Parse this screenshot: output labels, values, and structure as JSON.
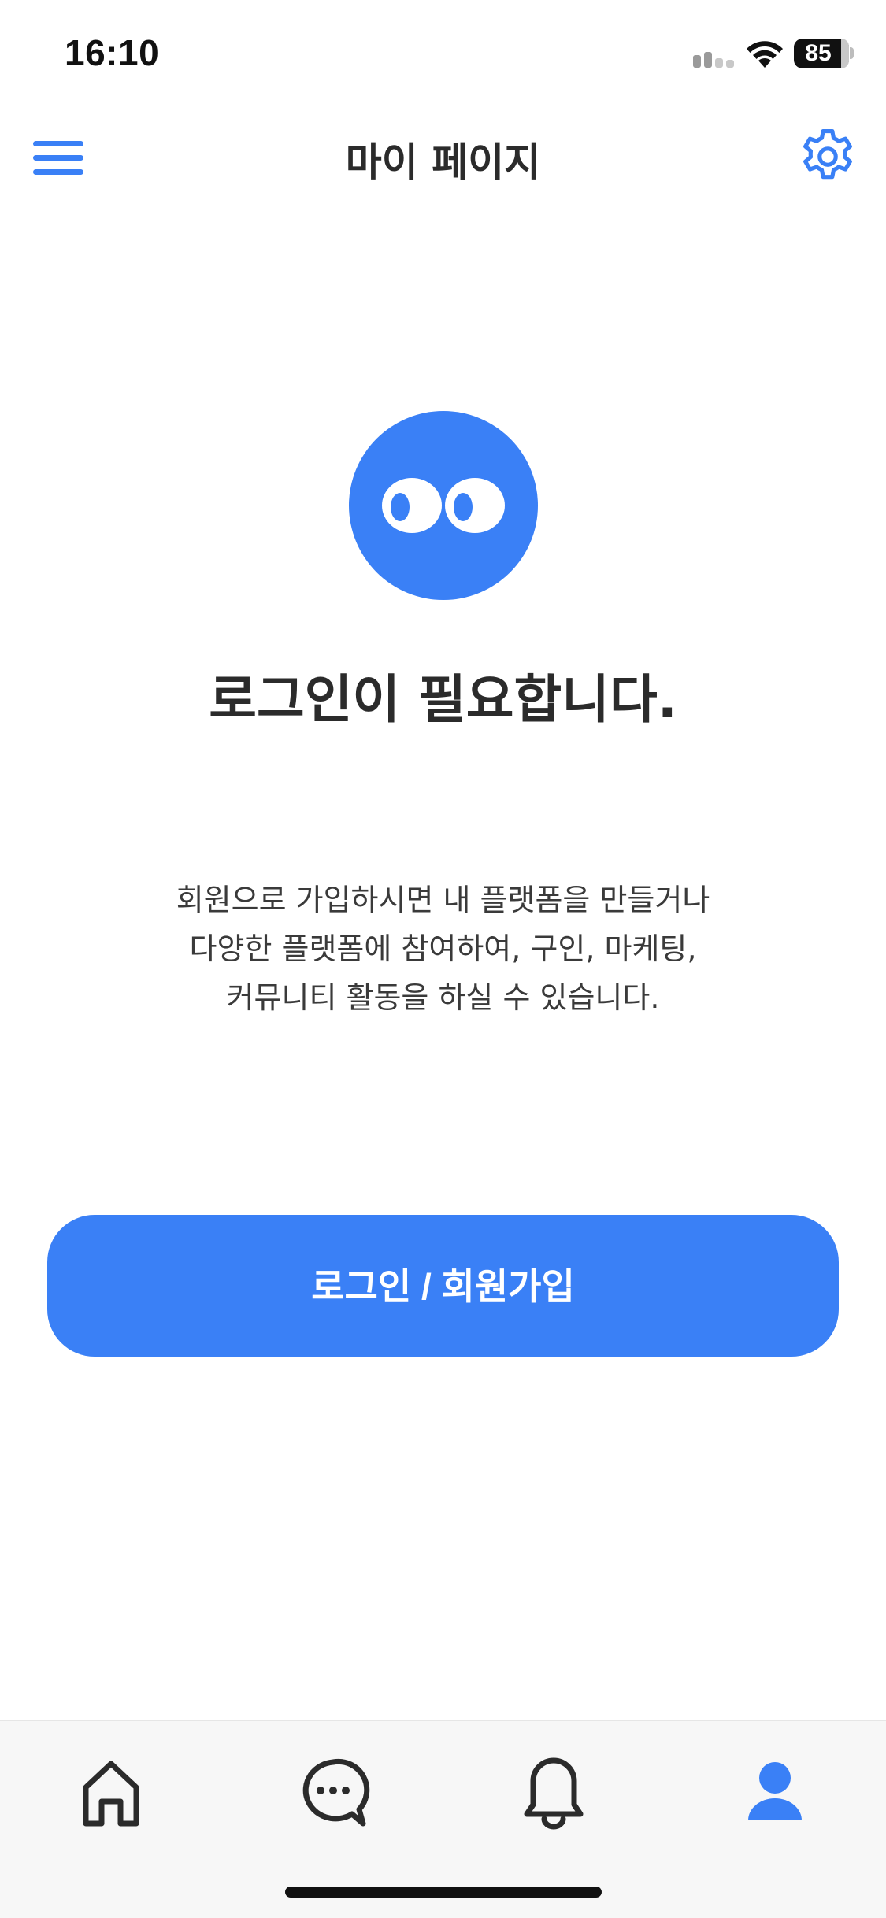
{
  "status_bar": {
    "time": "16:10",
    "battery_level": "85"
  },
  "header": {
    "title": "마이 페이지",
    "menu_icon": "hamburger-menu-icon",
    "settings_icon": "gear-icon"
  },
  "content": {
    "mascot_icon": "eyes-mascot-icon",
    "heading": "로그인이 필요합니다.",
    "description_lines": [
      "회원으로 가입하시면 내 플랫폼을 만들거나",
      "다양한 플랫폼에 참여하여, 구인, 마케팅,",
      "커뮤니티 활동을 하실 수 있습니다."
    ],
    "login_button_label": "로그인 / 회원가입"
  },
  "tab_bar": {
    "tabs": [
      {
        "icon": "home-icon",
        "active": false
      },
      {
        "icon": "chat-icon",
        "active": false
      },
      {
        "icon": "bell-icon",
        "active": false
      },
      {
        "icon": "profile-icon",
        "active": true
      }
    ]
  },
  "colors": {
    "accent": "#3a80f6",
    "text": "#2b2b2b",
    "tab_inactive": "#2b2b2b",
    "tab_bar_bg": "#f7f7f7"
  }
}
